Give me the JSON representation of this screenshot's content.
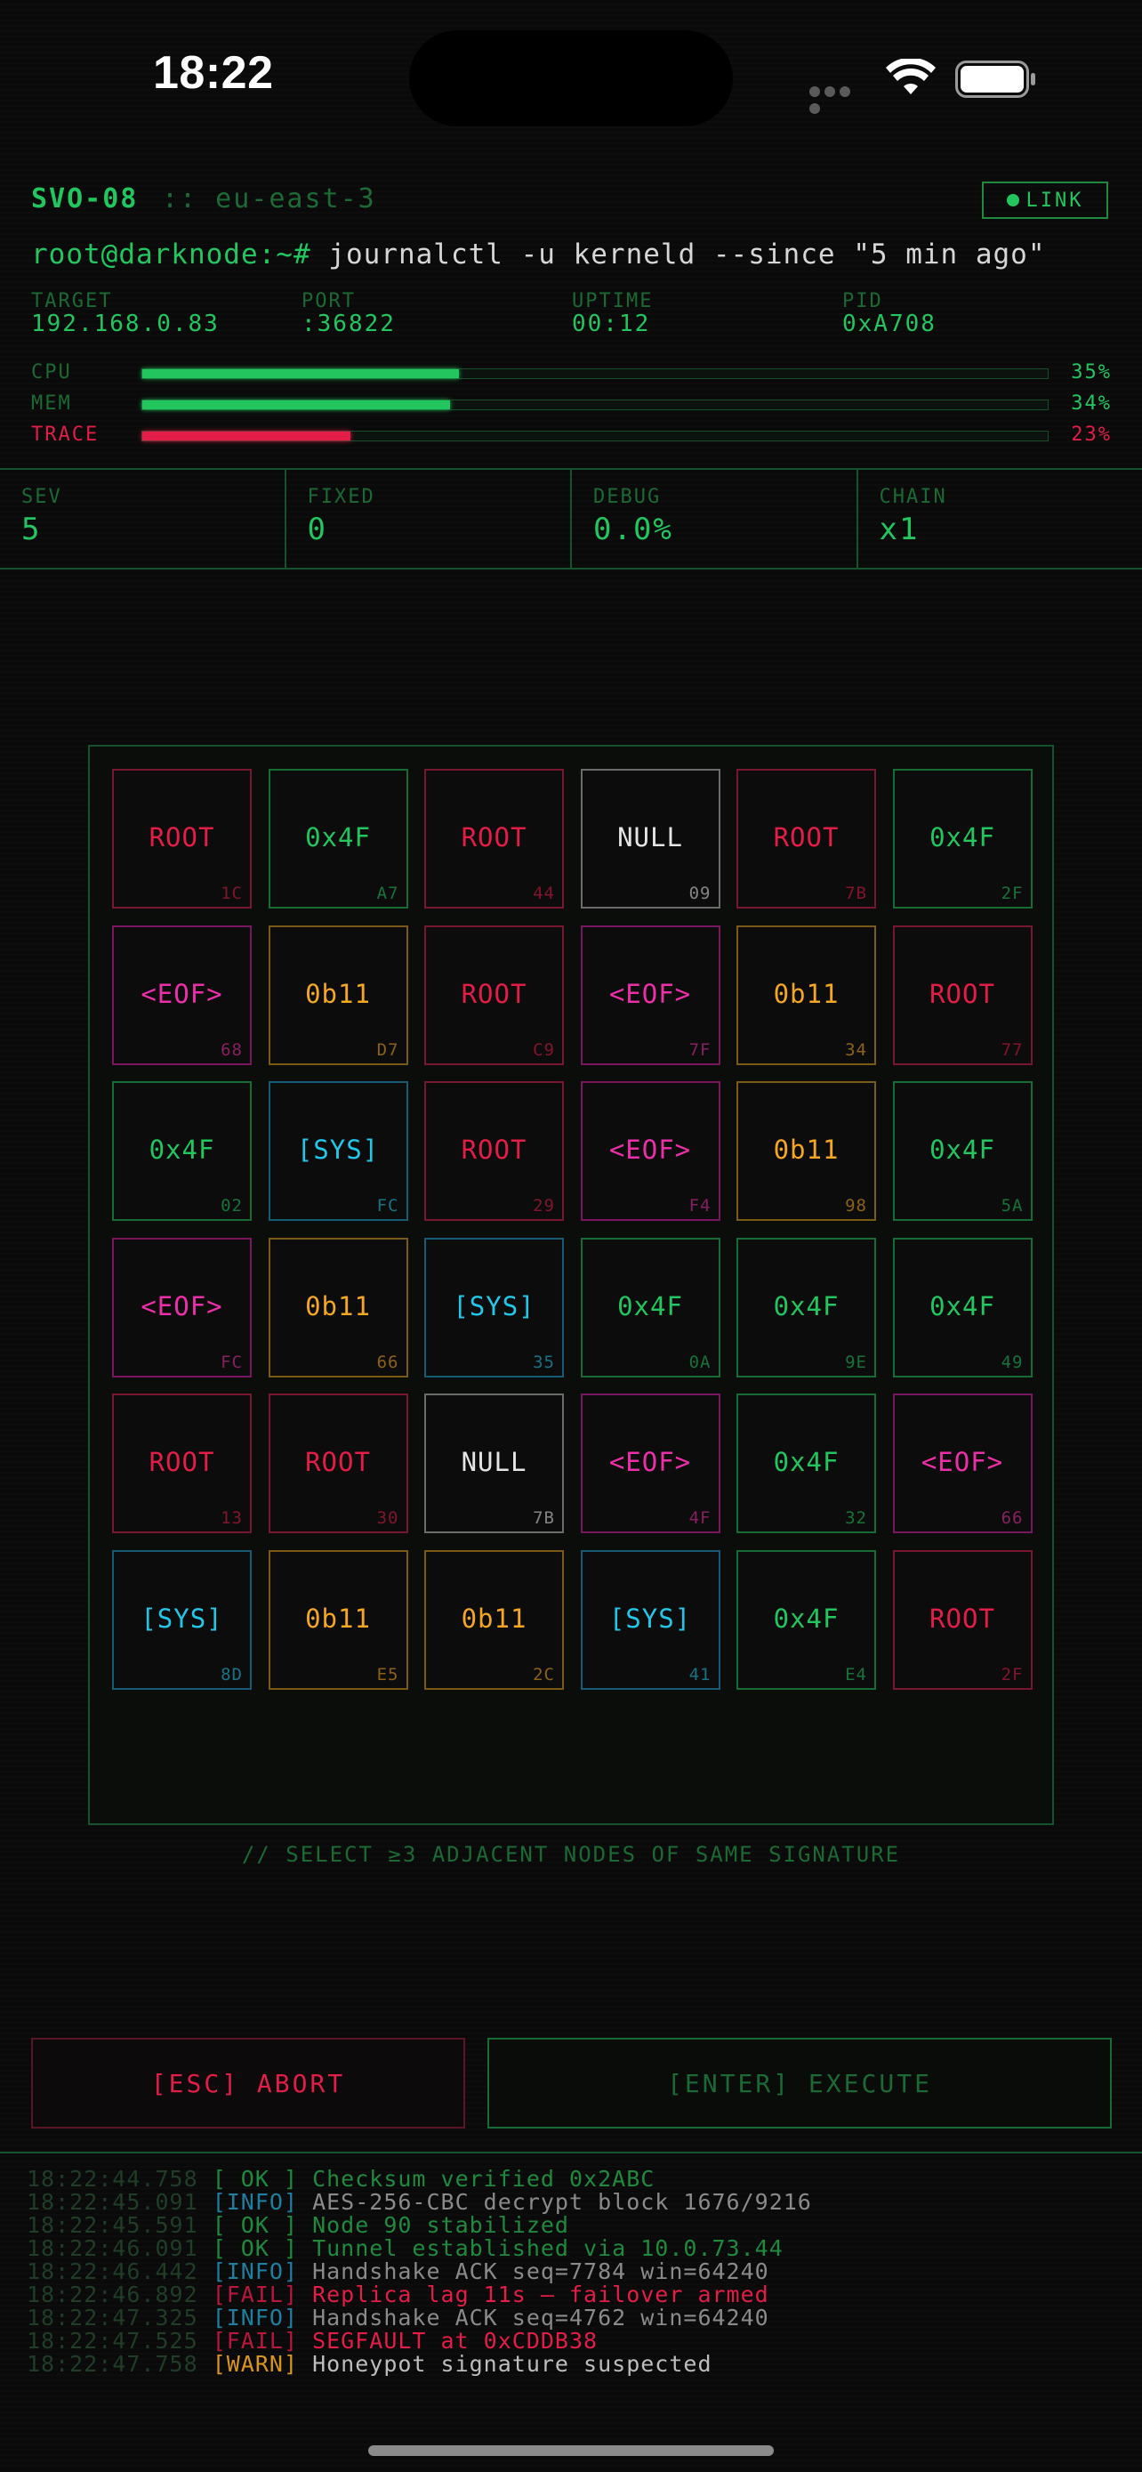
{
  "status_bar": {
    "time": "18:22"
  },
  "header": {
    "host": "SVO-08",
    "region": ":: eu-east-3",
    "link_label": "LINK",
    "prompt": "root@darknode:~#",
    "command": "journalctl -u kerneld --since \"5 min ago\""
  },
  "info": [
    {
      "label": "TARGET",
      "value": "192.168.0.83"
    },
    {
      "label": "PORT",
      "value": ":36822"
    },
    {
      "label": "UPTIME",
      "value": "00:12"
    },
    {
      "label": "PID",
      "value": "0xA708"
    }
  ],
  "meters": [
    {
      "label": "CPU",
      "value": 35,
      "text": "35%"
    },
    {
      "label": "MEM",
      "value": 34,
      "text": "34%"
    },
    {
      "label": "TRACE",
      "value": 23,
      "text": "23%"
    }
  ],
  "stats": [
    {
      "label": "SEV",
      "value": "5"
    },
    {
      "label": "FIXED",
      "value": "0"
    },
    {
      "label": "DEBUG",
      "value": "0.0%"
    },
    {
      "label": "CHAIN",
      "value": "x1"
    }
  ],
  "tile_types": {
    "root": "ROOT",
    "hex": "0x4F",
    "null": "NULL",
    "eof": "<EOF>",
    "bin": "0b11",
    "sys": "[SYS]"
  },
  "grid": [
    [
      [
        "root",
        "1C"
      ],
      [
        "hex",
        "A7"
      ],
      [
        "root",
        "44"
      ],
      [
        "null",
        "09"
      ],
      [
        "root",
        "7B"
      ],
      [
        "hex",
        "2F"
      ]
    ],
    [
      [
        "eof",
        "68"
      ],
      [
        "bin",
        "D7"
      ],
      [
        "root",
        "C9"
      ],
      [
        "eof",
        "7F"
      ],
      [
        "bin",
        "34"
      ],
      [
        "root",
        "77"
      ]
    ],
    [
      [
        "hex",
        "02"
      ],
      [
        "sys",
        "FC"
      ],
      [
        "root",
        "29"
      ],
      [
        "eof",
        "F4"
      ],
      [
        "bin",
        "98"
      ],
      [
        "hex",
        "5A"
      ]
    ],
    [
      [
        "eof",
        "FC"
      ],
      [
        "bin",
        "66"
      ],
      [
        "sys",
        "35"
      ],
      [
        "hex",
        "0A"
      ],
      [
        "hex",
        "9E"
      ],
      [
        "hex",
        "49"
      ]
    ],
    [
      [
        "root",
        "13"
      ],
      [
        "root",
        "30"
      ],
      [
        "null",
        "7B"
      ],
      [
        "eof",
        "4F"
      ],
      [
        "hex",
        "32"
      ],
      [
        "eof",
        "66"
      ]
    ],
    [
      [
        "sys",
        "8D"
      ],
      [
        "bin",
        "E5"
      ],
      [
        "bin",
        "2C"
      ],
      [
        "sys",
        "41"
      ],
      [
        "hex",
        "E4"
      ],
      [
        "root",
        "2F"
      ]
    ]
  ],
  "hint": "// SELECT ≥3 ADJACENT NODES OF SAME SIGNATURE",
  "buttons": {
    "abort": "[ESC] ABORT",
    "execute": "[ENTER] EXECUTE"
  },
  "log": [
    {
      "ts": "18:22:44.758",
      "tag": "[ OK ]",
      "level": "ok",
      "msg": "Checksum verified 0x2ABC"
    },
    {
      "ts": "18:22:45.091",
      "tag": "[INFO]",
      "level": "info",
      "msg": "AES-256-CBC decrypt block 1676/9216"
    },
    {
      "ts": "18:22:45.591",
      "tag": "[ OK ]",
      "level": "ok",
      "msg": "Node 90 stabilized"
    },
    {
      "ts": "18:22:46.091",
      "tag": "[ OK ]",
      "level": "ok",
      "msg": "Tunnel established via 10.0.73.44"
    },
    {
      "ts": "18:22:46.442",
      "tag": "[INFO]",
      "level": "info",
      "msg": "Handshake ACK seq=7784 win=64240"
    },
    {
      "ts": "18:22:46.892",
      "tag": "[FAIL]",
      "level": "fail",
      "msg": "Replica lag 11s — failover armed"
    },
    {
      "ts": "18:22:47.325",
      "tag": "[INFO]",
      "level": "info",
      "msg": "Handshake ACK seq=4762 win=64240"
    },
    {
      "ts": "18:22:47.525",
      "tag": "[FAIL]",
      "level": "fail",
      "msg": "SEGFAULT at 0xCDDB38"
    },
    {
      "ts": "18:22:47.758",
      "tag": "[WARN]",
      "level": "warn",
      "msg": "Honeypot signature suspected"
    }
  ],
  "colors": {
    "accent": "#22c55e",
    "danger": "#e11d48",
    "warn": "#f5a623",
    "sys": "#22c7e8",
    "eof": "#ec2fa8"
  }
}
